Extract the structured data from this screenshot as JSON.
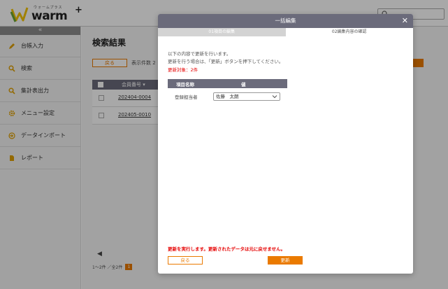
{
  "app": {
    "logo_subtitle": "ウォームプラス",
    "logo_text": "warm",
    "logo_plus": "+"
  },
  "sidebar": {
    "collapse_label": "«",
    "items": [
      {
        "label": "台帳入力",
        "icon": "pencil-icon"
      },
      {
        "label": "検索",
        "icon": "search-icon"
      },
      {
        "label": "集計表出力",
        "icon": "search-icon"
      },
      {
        "label": "メニュー設定",
        "icon": "gear-icon"
      },
      {
        "label": "データインポート",
        "icon": "import-icon"
      },
      {
        "label": "レポート",
        "icon": "document-icon"
      }
    ]
  },
  "main": {
    "title": "検索結果",
    "back_label": "戻る",
    "per_page_label": "表示件数",
    "per_page_value": "2",
    "table": {
      "header": "会員番号 ▾",
      "rows": [
        "202404-0004",
        "202405-0010"
      ]
    },
    "scroll_left": "◀",
    "paging_text": "1〜2件 ／全2件",
    "current_page": "1"
  },
  "modal": {
    "title": "一括編集",
    "close_label": "✕",
    "steps": [
      "01項目の編集",
      "02編集内容の確認"
    ],
    "description_line1": "以下の内容で更新を行います。",
    "description_line2": "更新を行う場合は、「更新」ボタンを押下してください。",
    "target_label": "更新対象：2件",
    "table": {
      "col_item": "項目名称",
      "col_value": "値",
      "rows": [
        {
          "name": "登録担当者",
          "value": "佐藤　太朗"
        }
      ]
    },
    "warning": "更新を実行します。更新されたデータは元に戻せません。",
    "back_label": "戻る",
    "update_label": "更新"
  },
  "colors": {
    "accent": "#ea7a00",
    "header": "#6b6b7b",
    "warning": "#e60000"
  }
}
